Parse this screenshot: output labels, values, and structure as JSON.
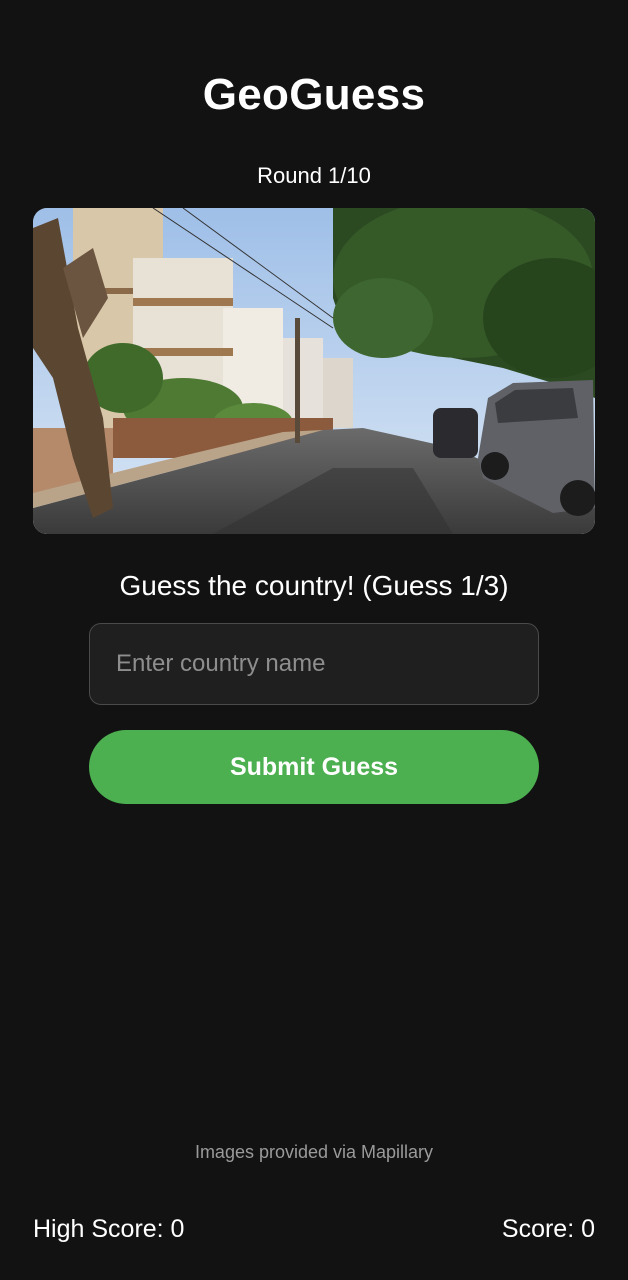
{
  "header": {
    "title": "GeoGuess",
    "round": "Round 1/10"
  },
  "image": {
    "description_icon": "street-photo"
  },
  "guess": {
    "prompt": "Guess the country! (Guess 1/3)",
    "input_placeholder": "Enter country name",
    "input_value": "",
    "submit_label": "Submit Guess"
  },
  "footer": {
    "attribution": "Images provided via Mapillary",
    "high_score": "High Score: 0",
    "score": "Score: 0"
  },
  "colors": {
    "background": "#121212",
    "accent": "#4caf50",
    "input_background": "#1f1f1f"
  }
}
